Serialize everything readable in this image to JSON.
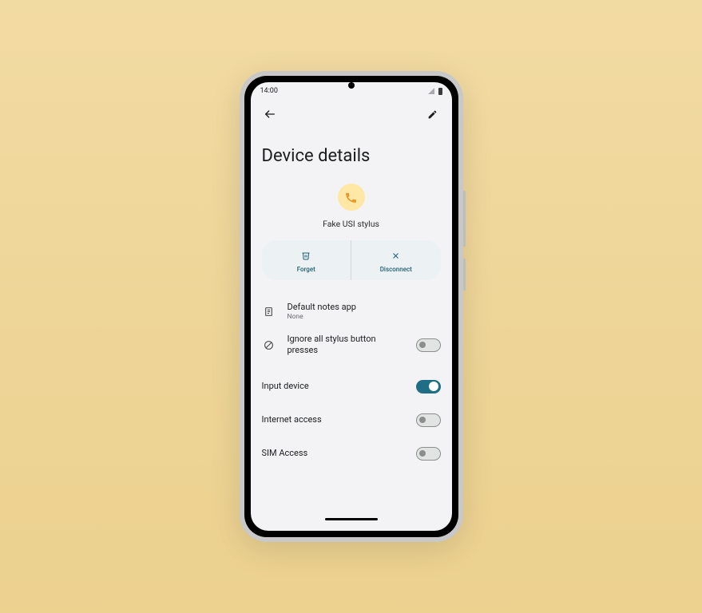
{
  "status": {
    "time": "14:00"
  },
  "header": {
    "page_title": "Device details"
  },
  "device": {
    "name": "Fake USI stylus"
  },
  "actions": {
    "forget": "Forget",
    "disconnect": "Disconnect"
  },
  "settings": {
    "default_notes": {
      "title": "Default notes app",
      "value": "None"
    },
    "ignore_buttons": {
      "title": "Ignore all stylus button presses",
      "enabled": false
    }
  },
  "profiles": {
    "input_device": {
      "label": "Input device",
      "enabled": true
    },
    "internet_access": {
      "label": "Internet access",
      "enabled": false
    },
    "sim_access": {
      "label": "SIM Access",
      "enabled": false
    }
  }
}
